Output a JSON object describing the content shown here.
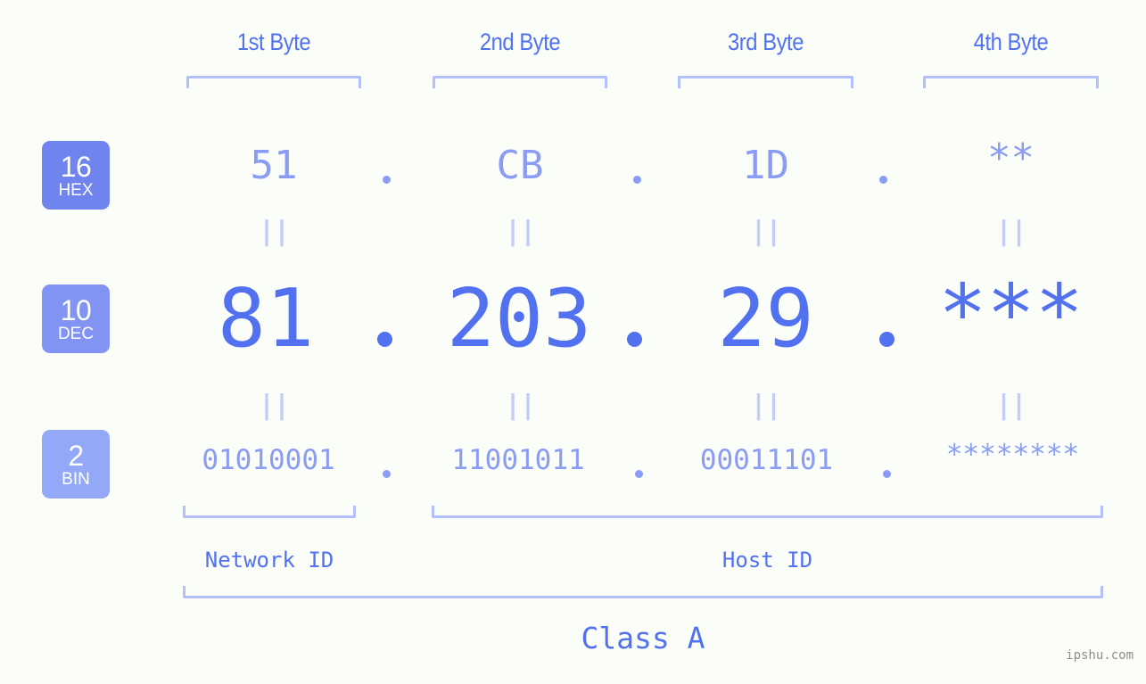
{
  "page": {
    "background_color": "#fbfdf8",
    "accent_strong": "#5271f0",
    "accent_mid": "#8a9cf3",
    "accent_light": "#b4c0fb",
    "watermark": "ipshu.com"
  },
  "byte_headers": [
    {
      "label": "1st Byte"
    },
    {
      "label": "2nd Byte"
    },
    {
      "label": "3rd Byte"
    },
    {
      "label": "4th Byte"
    }
  ],
  "bases": [
    {
      "number": "16",
      "name": "HEX",
      "color": "#7084f0"
    },
    {
      "number": "10",
      "name": "DEC",
      "color": "#8294f3"
    },
    {
      "number": "2",
      "name": "BIN",
      "color": "#93a8f6"
    }
  ],
  "rows": {
    "hex": {
      "values": [
        "51",
        "CB",
        "1D",
        "**"
      ]
    },
    "dec": {
      "values": [
        "81",
        "203",
        "29",
        "***"
      ]
    },
    "bin": {
      "values": [
        "01010001",
        "11001011",
        "00011101",
        "********"
      ]
    }
  },
  "separators": {
    "dot": ".",
    "equals": "||"
  },
  "segments": {
    "network_id": "Network ID",
    "host_id": "Host ID",
    "class": "Class A"
  }
}
